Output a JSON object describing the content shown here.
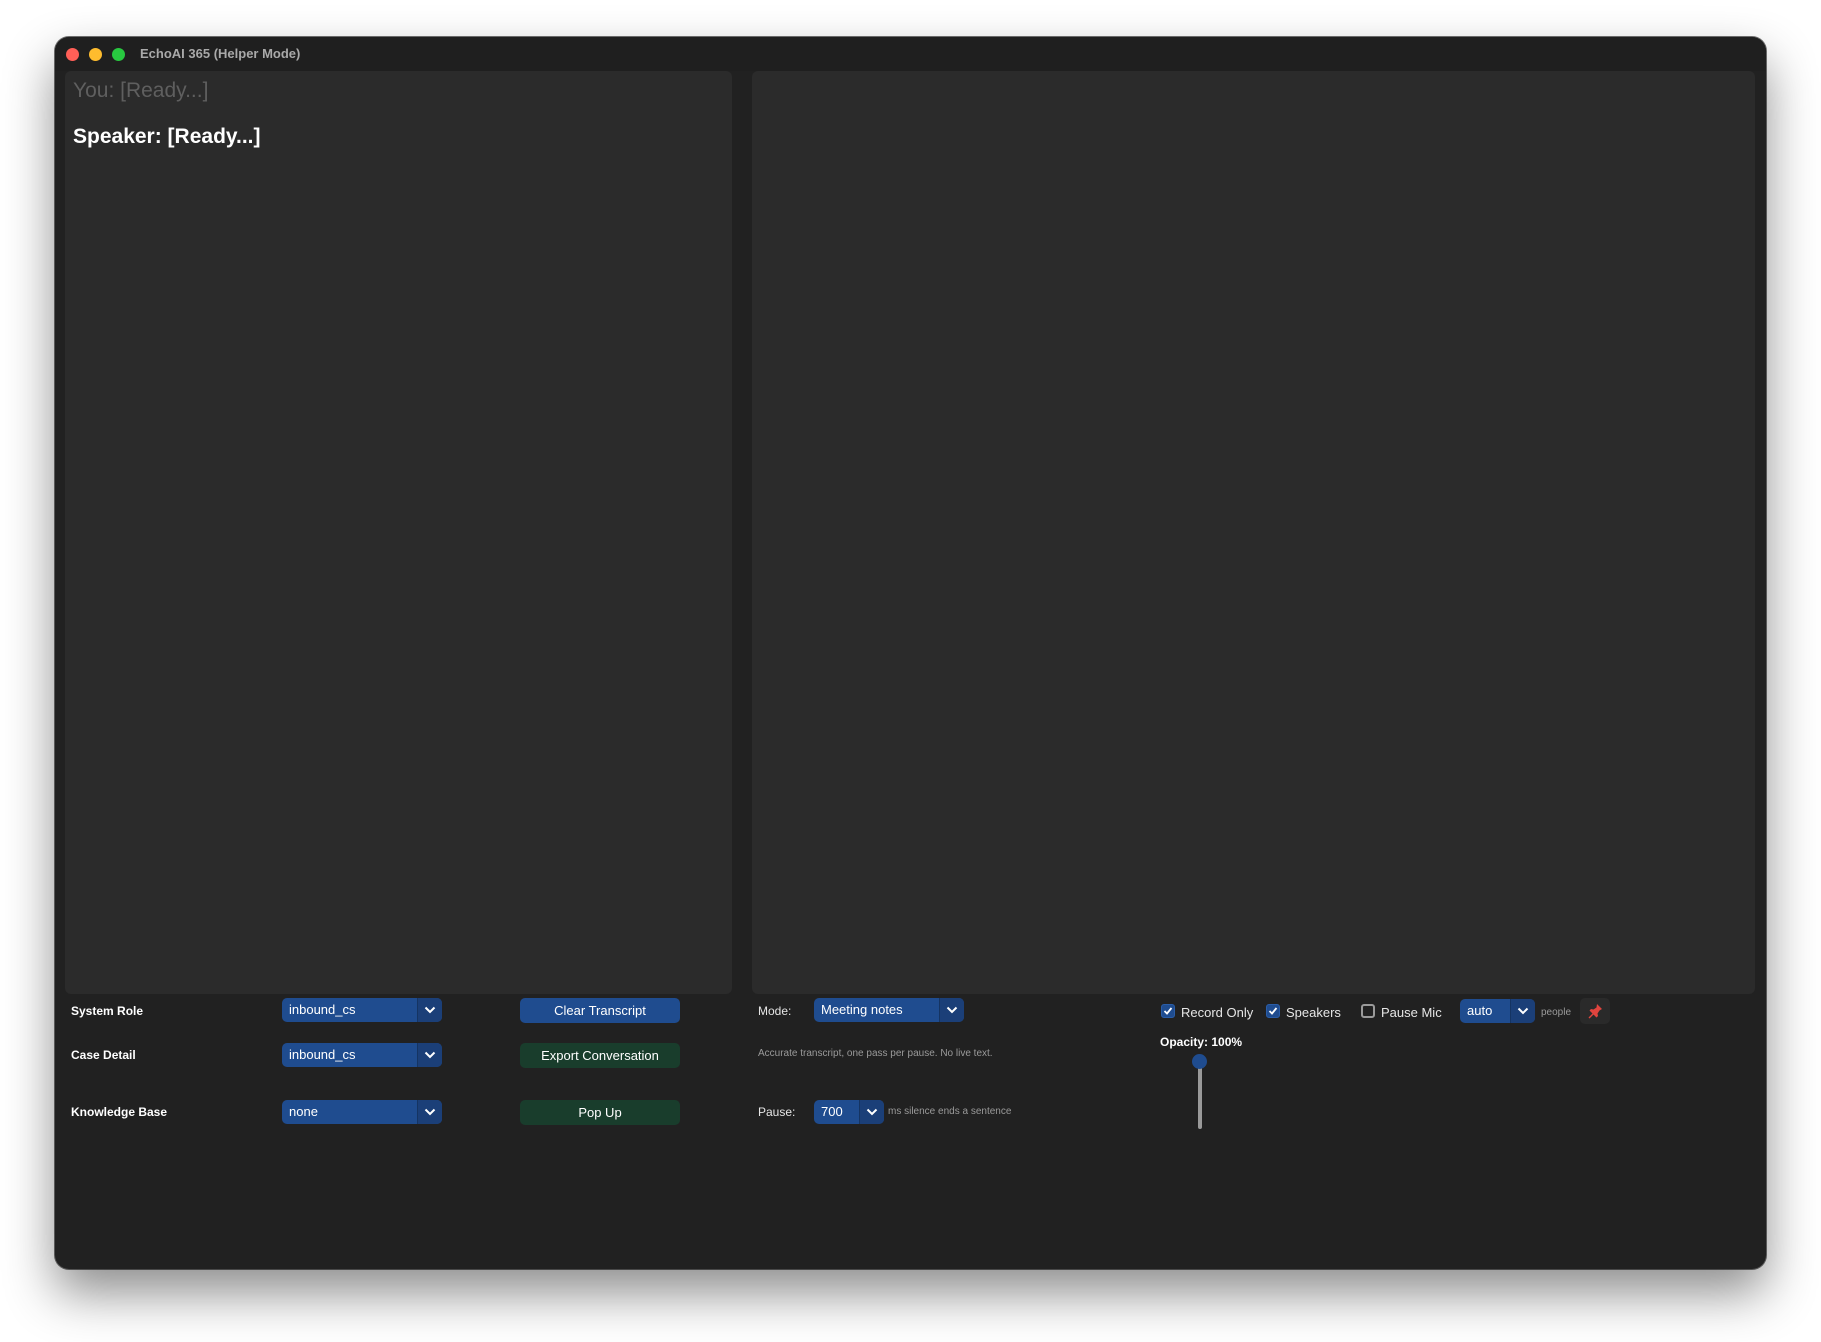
{
  "window": {
    "title": "EchoAI 365 (Helper Mode)"
  },
  "transcript": {
    "you_line": "You: [Ready...]",
    "speaker_line": "Speaker: [Ready...]"
  },
  "settings": {
    "system_role": {
      "label": "System Role",
      "value": "inbound_cs"
    },
    "case_detail": {
      "label": "Case Detail",
      "value": "inbound_cs"
    },
    "knowledge_base": {
      "label": "Knowledge Base",
      "value": "none"
    }
  },
  "actions": {
    "clear_transcript": "Clear Transcript",
    "export_conversation": "Export Conversation",
    "pop_up": "Pop Up"
  },
  "mode": {
    "label": "Mode:",
    "value": "Meeting notes",
    "description": "Accurate transcript, one pass per pause. No live text."
  },
  "pause": {
    "label": "Pause:",
    "value": "700",
    "hint": "ms silence ends a sentence"
  },
  "options": {
    "record_only": {
      "label": "Record Only",
      "checked": true
    },
    "speakers": {
      "label": "Speakers",
      "checked": true
    },
    "pause_mic": {
      "label": "Pause Mic",
      "checked": false
    }
  },
  "people": {
    "value": "auto",
    "label": "people"
  },
  "opacity": {
    "label": "Opacity: 100%",
    "value_percent": 100
  },
  "colors": {
    "window_bg": "#212121",
    "panel_bg": "#2b2b2b",
    "accent_blue": "#1f4c8f",
    "button_green": "#193d2c",
    "pin_red": "#e0443e"
  },
  "icons": {
    "dropdown": "chevron-down-icon",
    "checkbox": "checkmark-icon",
    "pin": "pushpin-icon"
  }
}
